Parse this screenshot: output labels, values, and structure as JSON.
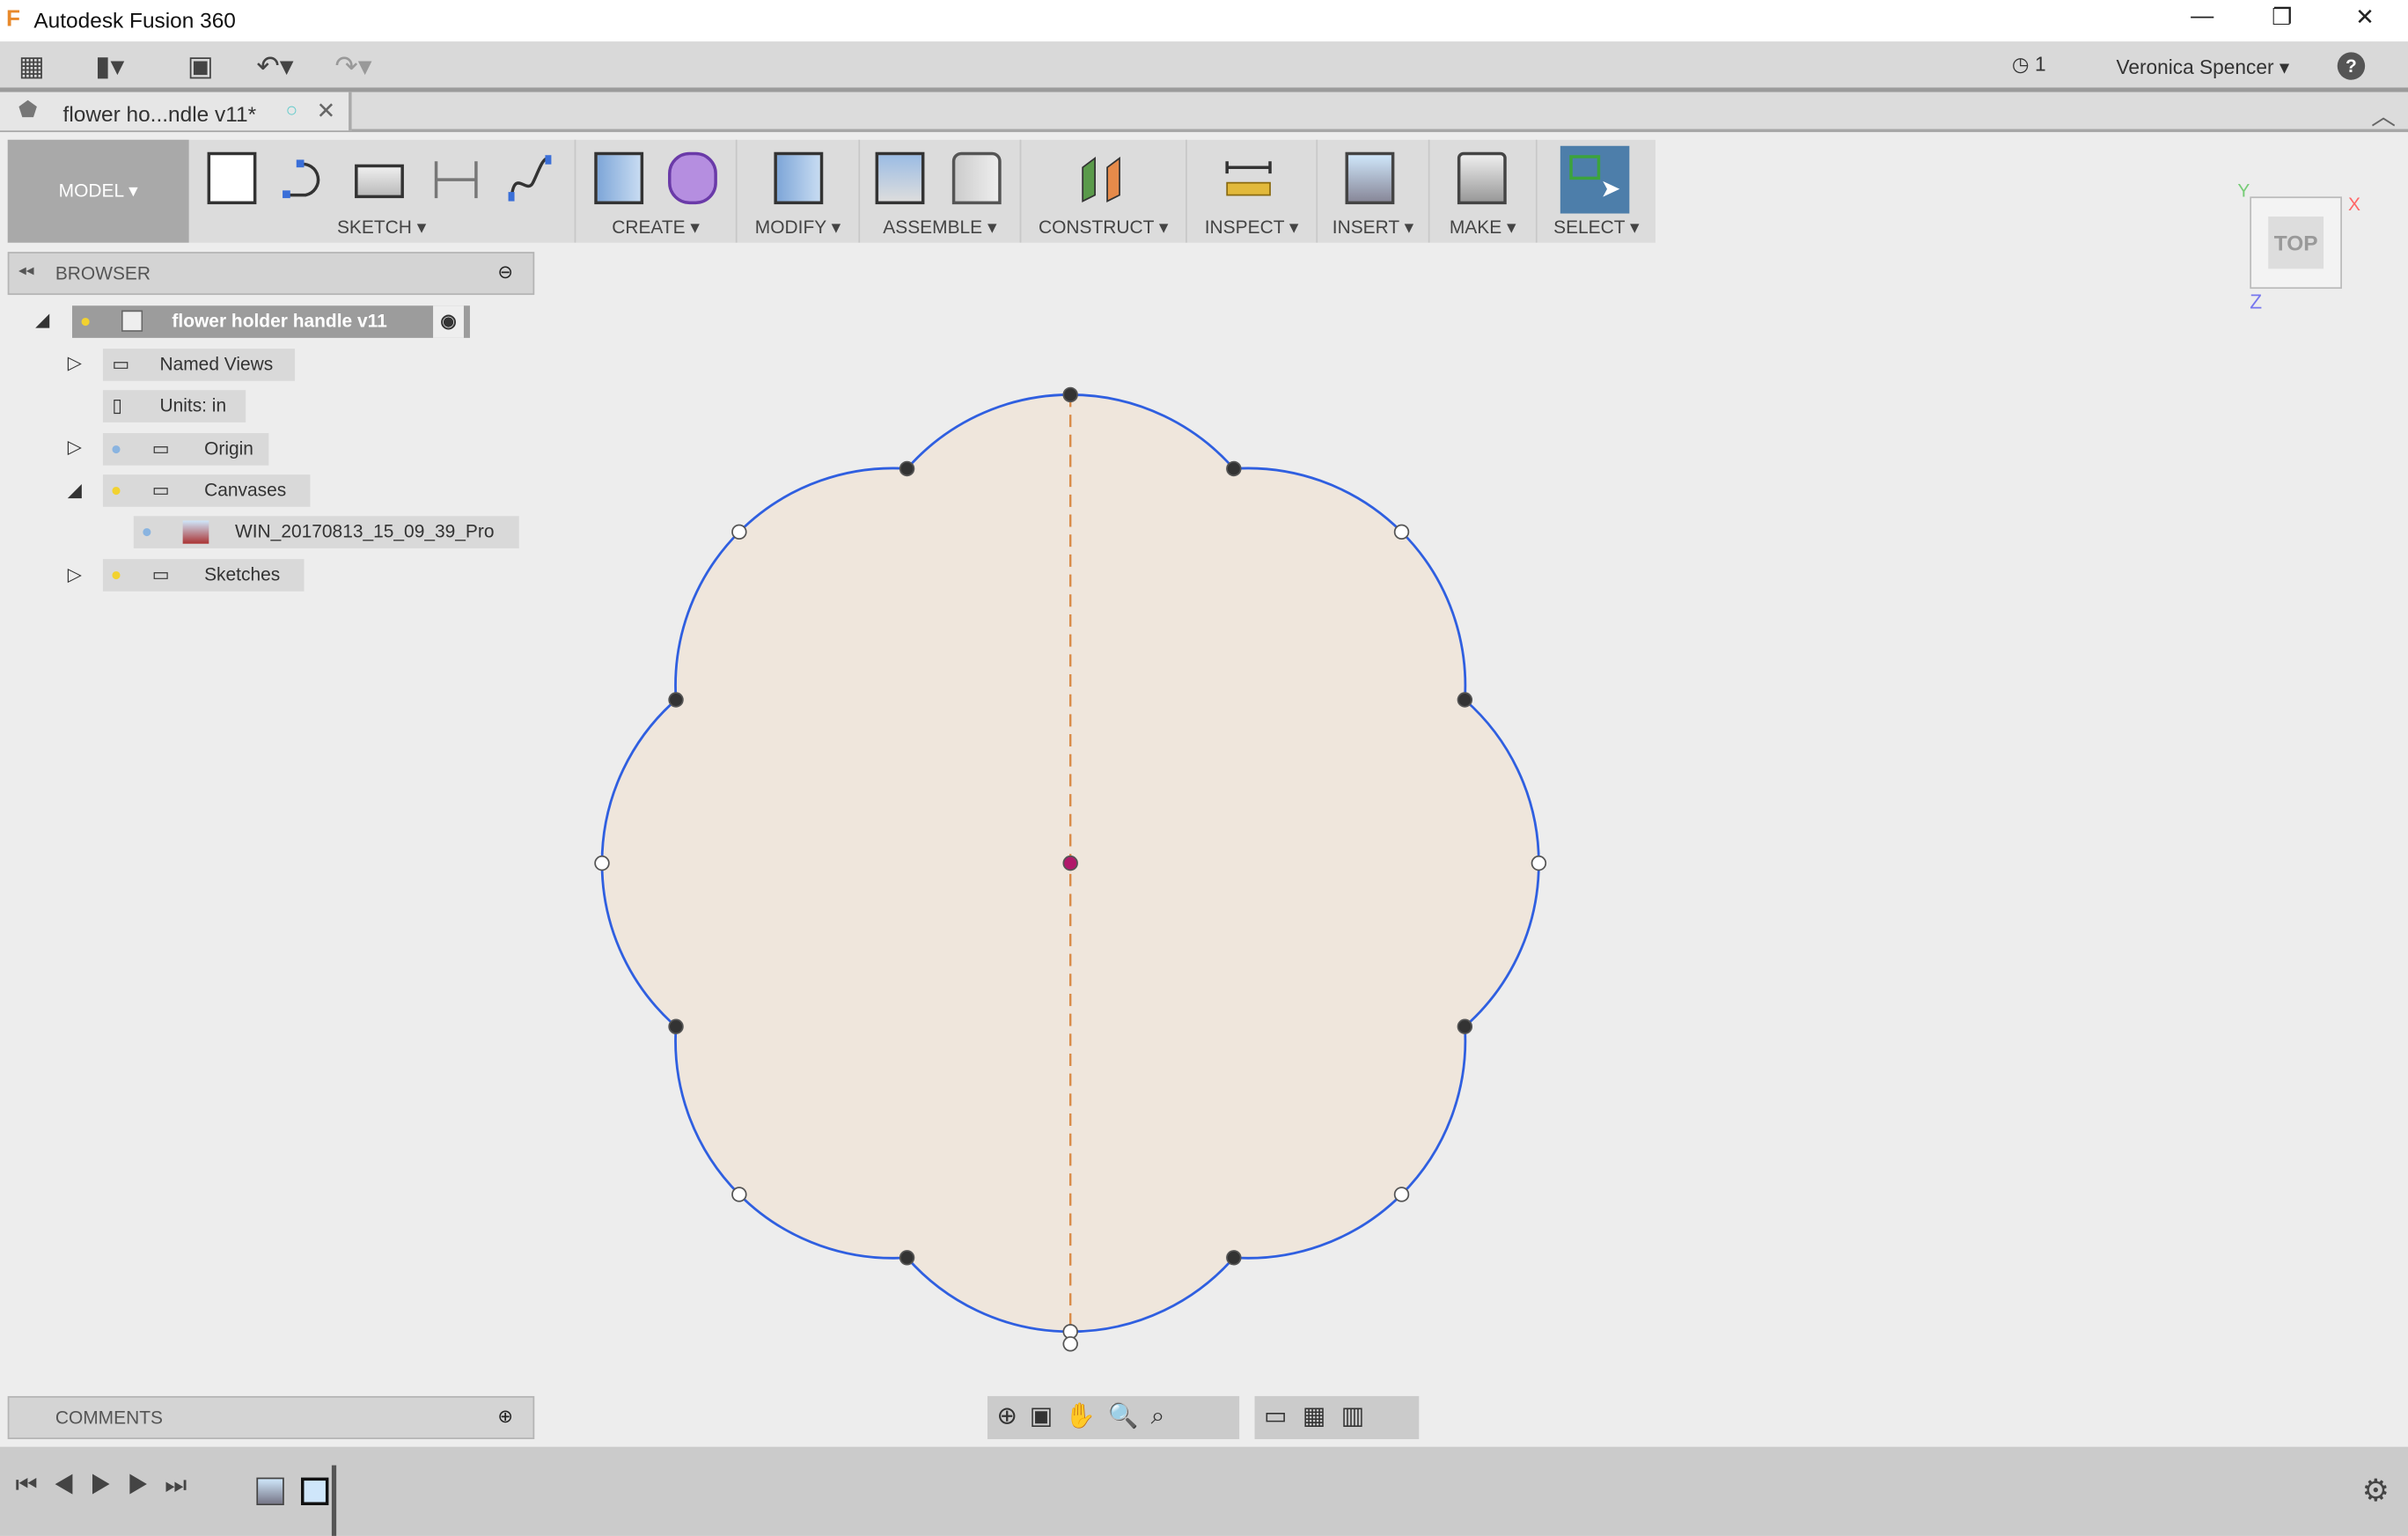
{
  "window": {
    "title": "Autodesk Fusion 360",
    "minimize": "—",
    "restore": "❐",
    "close": "✕"
  },
  "quick_access": {
    "jobs_count": "1",
    "user": "Veronica Spencer",
    "help": "?"
  },
  "document_tab": {
    "title": "flower ho...ndle v11*"
  },
  "toolbar": {
    "workspace": "MODEL",
    "groups": [
      "SKETCH",
      "CREATE",
      "MODIFY",
      "ASSEMBLE",
      "CONSTRUCT",
      "INSPECT",
      "INSERT",
      "MAKE",
      "SELECT"
    ]
  },
  "browser": {
    "title": "BROWSER",
    "root": "flower holder handle v11",
    "items": [
      "Named Views",
      "Units: in",
      "Origin",
      "Canvases",
      "WIN_20170813_15_09_39_Pro",
      "Sketches"
    ]
  },
  "comments": {
    "title": "COMMENTS"
  },
  "viewcube": {
    "face": "TOP",
    "x": "X",
    "y": "Y",
    "z": "Z"
  },
  "sketch": {
    "lobes": 8,
    "profile_fill": "#efe6dc",
    "curve_color": "#2f5fe0",
    "axis_color": "#d98c4a",
    "center_color": "#b0186a"
  },
  "colors": {
    "select_active": "#4d7eaa"
  }
}
